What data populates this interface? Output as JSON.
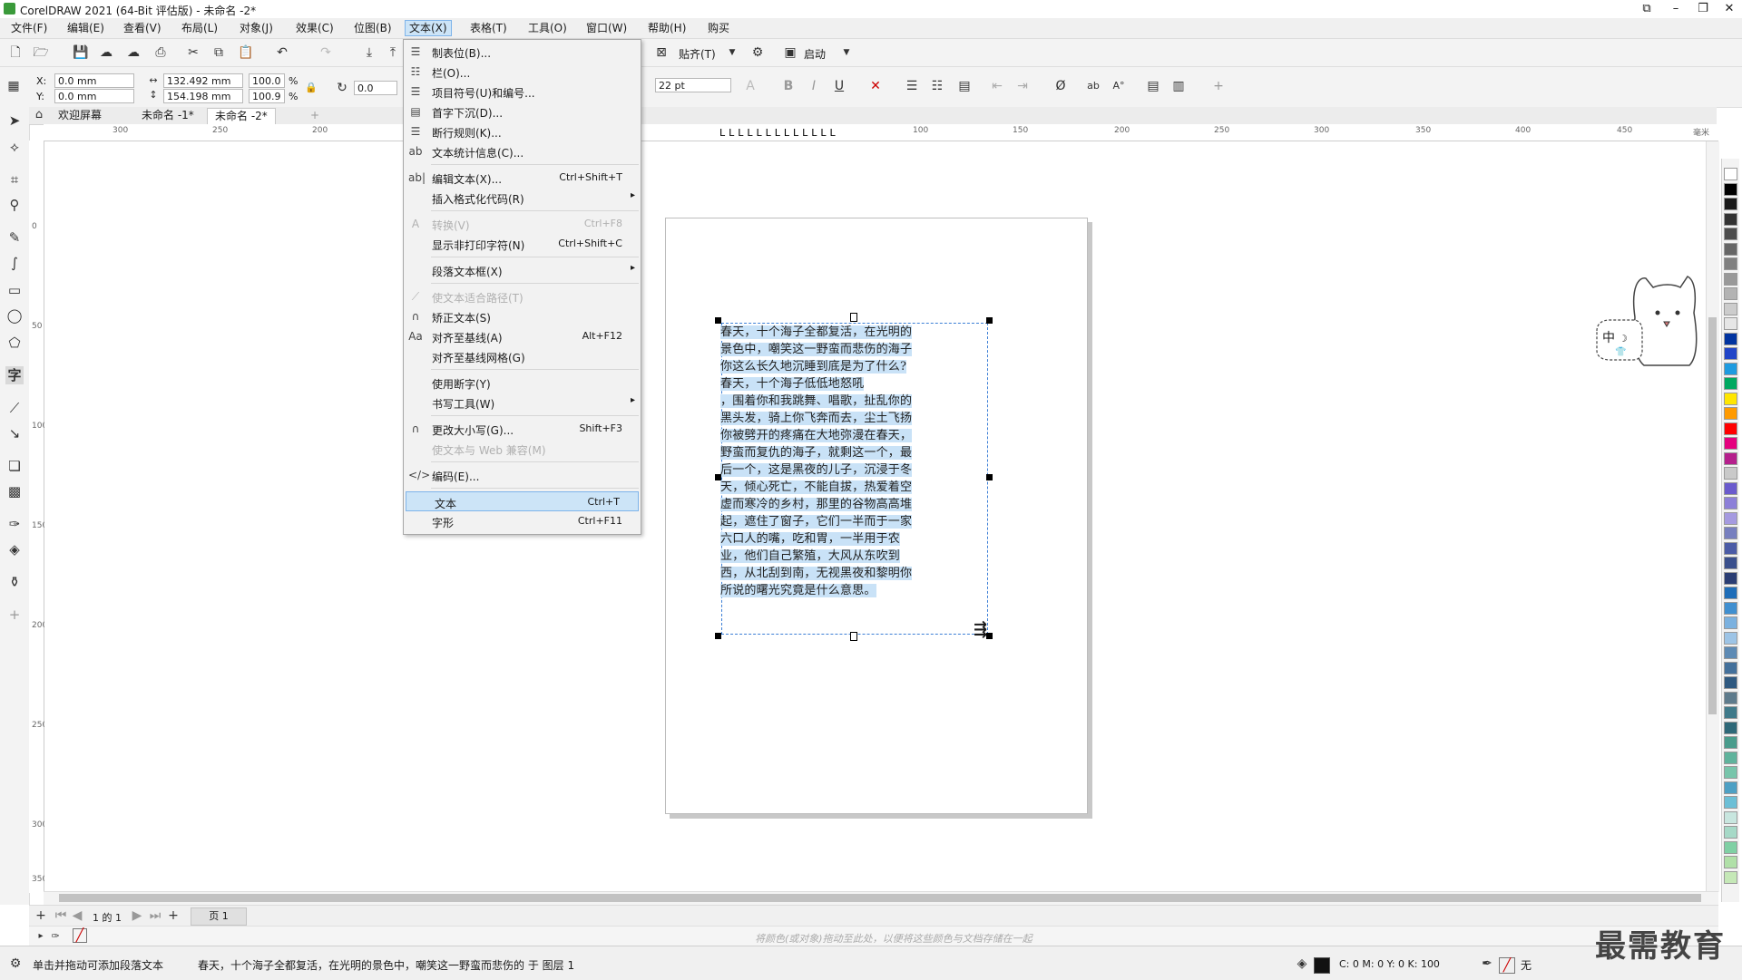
{
  "window": {
    "title": "CorelDRAW 2021 (64-Bit 评估版) - 未命名 -2*"
  },
  "menubar": {
    "items": [
      {
        "label": "文件(F)"
      },
      {
        "label": "编辑(E)"
      },
      {
        "label": "查看(V)"
      },
      {
        "label": "布局(L)"
      },
      {
        "label": "对象(J)"
      },
      {
        "label": "效果(C)"
      },
      {
        "label": "位图(B)"
      },
      {
        "label": "文本(X)"
      },
      {
        "label": "表格(T)"
      },
      {
        "label": "工具(O)"
      },
      {
        "label": "窗口(W)"
      },
      {
        "label": "帮助(H)"
      },
      {
        "label": "购买"
      }
    ]
  },
  "toolbar1": {
    "snap_label": "贴齐(T)",
    "launch_label": "启动"
  },
  "propbar": {
    "x_label": "X:",
    "x_value": "0.0 mm",
    "y_label": "Y:",
    "y_value": "0.0 mm",
    "w_value": "132.492 mm",
    "h_value": "154.198 mm",
    "scale_w": "100.0",
    "scale_h": "100.9",
    "pct": "%",
    "rotation": "0.0",
    "font_size": "22 pt"
  },
  "doctabs": {
    "welcome": "欢迎屏幕",
    "doc1": "未命名 -1*",
    "doc2": "未命名 -2*",
    "add": "+"
  },
  "ruler": {
    "h_labels": [
      "300",
      "250",
      "200",
      "100",
      "150",
      "200",
      "250",
      "300",
      "350",
      "400",
      "450"
    ],
    "unit": "毫米",
    "v_labels": [
      "0",
      "50",
      "100",
      "150",
      "200",
      "250",
      "300",
      "350"
    ]
  },
  "paragraph_text": [
    "春天，十个海子全都复活，在光明的",
    "景色中，嘲笑这一野蛮而悲伤的海子",
    "你这么长久地沉睡到底是为了什么?",
    "春天，十个海子低低地怒吼",
    "，围着你和我跳舞、唱歌，扯乱你的",
    "黑头发，骑上你飞奔而去，尘土飞扬",
    "你被劈开的疼痛在大地弥漫在春天，",
    "野蛮而复仇的海子，就剩这一个，最",
    "后一个，这是黑夜的儿子，沉浸于冬",
    "天，倾心死亡，不能自拔，热爱着空",
    "虚而寒冷的乡村，那里的谷物高高堆",
    "起，遮住了窗子，它们一半而于一家",
    "六口人的嘴，吃和胃，一半用于农",
    "业，他们自己繁殖，大风从东吹到",
    "西，从北刮到南，无视黑夜和黎明你",
    "所说的曙光究竟是什么意思。"
  ],
  "text_menu": {
    "items": [
      {
        "icon": "tabs-icon",
        "glyph": "☰",
        "label": "制表位(B)...",
        "shortcut": "",
        "arrow": false,
        "disabled": false
      },
      {
        "icon": "columns-icon",
        "glyph": "☷",
        "label": "栏(O)...",
        "shortcut": "",
        "arrow": false,
        "disabled": false
      },
      {
        "icon": "bullets-icon",
        "glyph": "☰",
        "label": "项目符号(U)和编号...",
        "shortcut": "",
        "arrow": false,
        "disabled": false
      },
      {
        "icon": "dropcap-icon",
        "glyph": "▤",
        "label": "首字下沉(D)...",
        "shortcut": "",
        "arrow": false,
        "disabled": false
      },
      {
        "icon": "linebreak-icon",
        "glyph": "☰",
        "label": "断行规则(K)...",
        "shortcut": "",
        "arrow": false,
        "disabled": false
      },
      {
        "icon": "text-stats-icon",
        "glyph": "ab",
        "label": "文本统计信息(C)...",
        "shortcut": "",
        "arrow": false,
        "disabled": false
      },
      {
        "sep": true
      },
      {
        "icon": "edit-text-icon",
        "glyph": "ab|",
        "label": "编辑文本(X)...",
        "shortcut": "Ctrl+Shift+T",
        "arrow": false,
        "disabled": false
      },
      {
        "icon": "",
        "glyph": "",
        "label": "插入格式化代码(R)",
        "shortcut": "",
        "arrow": true,
        "disabled": false
      },
      {
        "sep": true
      },
      {
        "icon": "convert-icon",
        "glyph": "A",
        "label": "转换(V)",
        "shortcut": "Ctrl+F8",
        "arrow": false,
        "disabled": true
      },
      {
        "icon": "",
        "glyph": "",
        "label": "显示非打印字符(N)",
        "shortcut": "Ctrl+Shift+C",
        "arrow": false,
        "disabled": false
      },
      {
        "sep": true
      },
      {
        "icon": "",
        "glyph": "",
        "label": "段落文本框(X)",
        "shortcut": "",
        "arrow": true,
        "disabled": false
      },
      {
        "sep": true
      },
      {
        "icon": "fit-path-icon",
        "glyph": "⟋",
        "label": "使文本适合路径(T)",
        "shortcut": "",
        "arrow": false,
        "disabled": true
      },
      {
        "icon": "straighten-icon",
        "glyph": "∩",
        "label": "矫正文本(S)",
        "shortcut": "",
        "arrow": false,
        "disabled": false
      },
      {
        "icon": "baseline-icon",
        "glyph": "Aa",
        "label": "对齐至基线(A)",
        "shortcut": "Alt+F12",
        "arrow": false,
        "disabled": false
      },
      {
        "icon": "",
        "glyph": "",
        "label": "对齐至基线网格(G)",
        "shortcut": "",
        "arrow": false,
        "disabled": false
      },
      {
        "sep": true
      },
      {
        "icon": "",
        "glyph": "",
        "label": "使用断字(Y)",
        "shortcut": "",
        "arrow": false,
        "disabled": false
      },
      {
        "icon": "",
        "glyph": "",
        "label": "书写工具(W)",
        "shortcut": "",
        "arrow": true,
        "disabled": false
      },
      {
        "sep": true
      },
      {
        "icon": "change-case-icon",
        "glyph": "∩",
        "label": "更改大小写(G)...",
        "shortcut": "Shift+F3",
        "arrow": false,
        "disabled": false
      },
      {
        "icon": "",
        "glyph": "",
        "label": "使文本与 Web 兼容(M)",
        "shortcut": "",
        "arrow": false,
        "disabled": true
      },
      {
        "sep": true
      },
      {
        "icon": "encode-icon",
        "glyph": "</>",
        "label": "编码(E)...",
        "shortcut": "",
        "arrow": false,
        "disabled": false
      },
      {
        "sep": true
      },
      {
        "icon": "",
        "glyph": "",
        "label": "文本",
        "shortcut": "Ctrl+T",
        "arrow": false,
        "disabled": false,
        "highlight": true
      },
      {
        "icon": "",
        "glyph": "",
        "label": "字形",
        "shortcut": "Ctrl+F11",
        "arrow": false,
        "disabled": false
      }
    ]
  },
  "pagebar": {
    "page_info": "1 的 1",
    "page_tab": "页 1"
  },
  "colorbar": {
    "hint": "将颜色(或对象)拖动至此处，以便将这些颜色与文档存储在一起"
  },
  "statusbar": {
    "hint": "单击并拖动可添加段落文本",
    "object_info": "春天，十个海子全都复活，在光明的景色中，嘲笑这一野蛮而悲伤的 于 图层 1",
    "fill_label": "C: 0 M: 0 Y: 0 K: 100",
    "outline_label": "无"
  },
  "mascot": {
    "text": "中"
  },
  "watermark": "最需教育",
  "palette_colors": [
    "#ffffff",
    "#000000",
    "#1a1a1a",
    "#333333",
    "#4d4d4d",
    "#666666",
    "#808080",
    "#999999",
    "#b3b3b3",
    "#cccccc",
    "#e6e6e6",
    "#0033a0",
    "#2145c8",
    "#1e9be0",
    "#00a860",
    "#ffe600",
    "#ff9a00",
    "#ff0000",
    "#e5007e",
    "#b51f8c",
    "#c9c9c9",
    "#6a5acd",
    "#8c7fd8",
    "#a59ae0",
    "#777fbf",
    "#4b5ba6",
    "#3a4f8c",
    "#2a3d73",
    "#1e6db8",
    "#3f8fd0",
    "#7bb1df",
    "#9dc4e6",
    "#5d8ab4",
    "#43709b",
    "#2f5980",
    "#5e7b8c",
    "#407a8a",
    "#2e6878",
    "#4a9c8c",
    "#5fb39c",
    "#78c5ab",
    "#4da0c4",
    "#6cbfd6",
    "#c8e6df",
    "#a6d9c7",
    "#7fd0a4",
    "#b0e0a8",
    "#c5e8b7"
  ]
}
